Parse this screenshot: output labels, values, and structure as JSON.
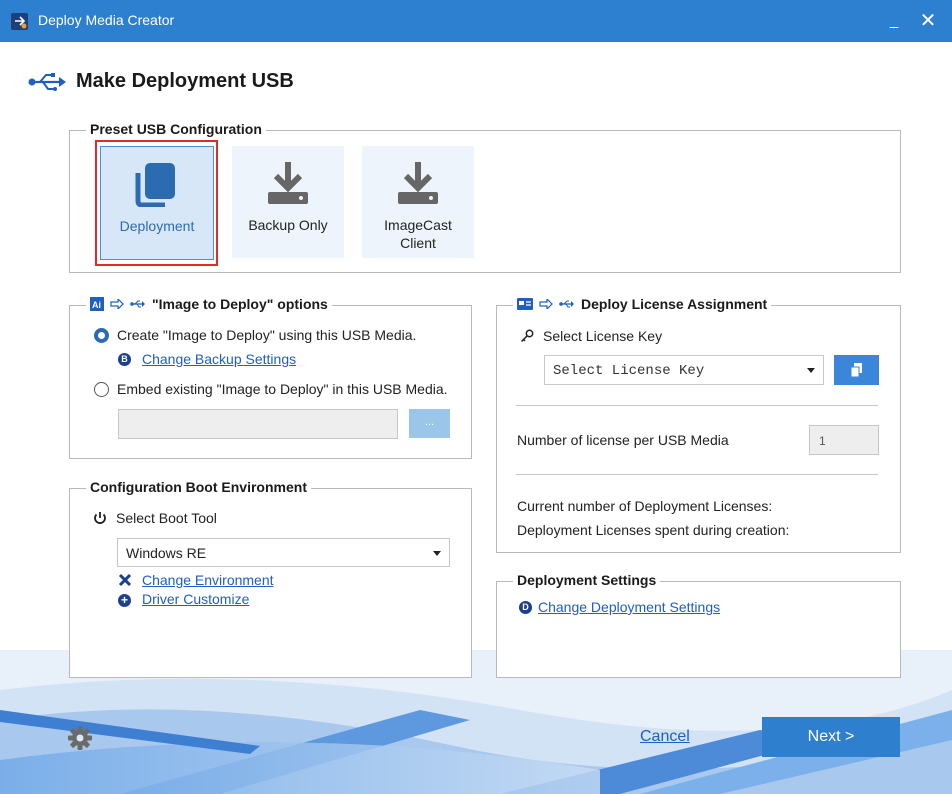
{
  "window": {
    "title": "Deploy Media Creator",
    "minimize_label": "_",
    "close_label": "✕"
  },
  "header": {
    "title": "Make Deployment USB",
    "icon": "usb-icon"
  },
  "preset": {
    "legend": "Preset USB Configuration",
    "tiles": [
      {
        "label": "Deployment",
        "icon": "copy-icon",
        "selected": true
      },
      {
        "label": "Backup Only",
        "icon": "download-drive-icon",
        "selected": false
      },
      {
        "label": "ImageCast Client",
        "icon": "download-drive-icon",
        "selected": false
      }
    ]
  },
  "image_options": {
    "legend": "\"Image to Deploy\" options",
    "option_create": "Create \"Image to Deploy\" using this USB Media.",
    "change_backup_link": "Change Backup Settings",
    "option_embed": "Embed existing \"Image to Deploy\" in this USB Media.",
    "browse_label": "...",
    "path_value": ""
  },
  "boot_env": {
    "legend": "Configuration Boot Environment",
    "select_label": "Select Boot Tool",
    "selected_tool": "Windows RE",
    "change_env_link": "Change Environment",
    "driver_link": "Driver Customize"
  },
  "license": {
    "legend": "Deploy License Assignment",
    "select_label": "Select License Key",
    "select_placeholder": "Select License Key",
    "count_label": "Number of license per USB Media",
    "count_value": "1",
    "current_label": "Current number of Deployment Licenses:",
    "spent_label": "Deployment Licenses spent during creation:"
  },
  "deploy_settings": {
    "legend": "Deployment Settings",
    "change_link": "Change Deployment Settings"
  },
  "footer": {
    "cancel_label": "Cancel",
    "next_label": "Next >"
  },
  "colors": {
    "titlebar": "#2d7fd0",
    "accent": "#2b6cb0",
    "selection_outline": "#e02b2b",
    "next_button": "#2f7fcf"
  }
}
